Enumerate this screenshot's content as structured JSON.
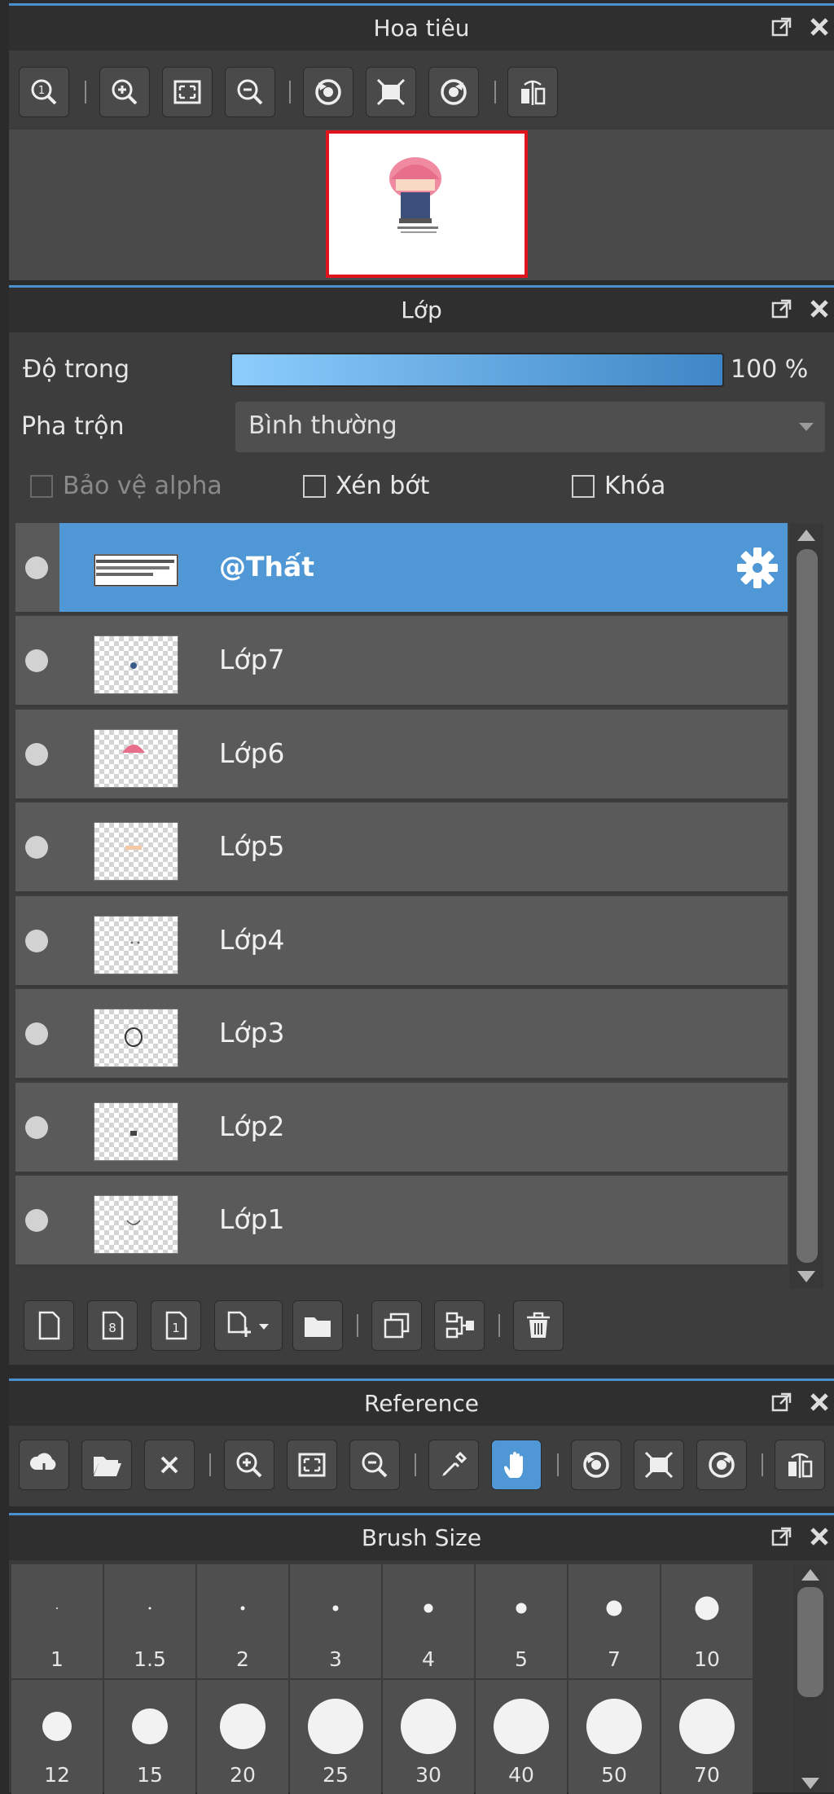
{
  "navigator": {
    "title": "Hoa tiêu",
    "buttons": [
      "zoom-actual-size",
      "zoom-in",
      "fit-to-window",
      "zoom-out",
      "rotate-left",
      "reset-rotation",
      "rotate-right",
      "flip-horizontal"
    ]
  },
  "layers": {
    "title": "Lớp",
    "opacity_label": "Độ trong",
    "opacity_value": "100 %",
    "opacity_fraction": 1.0,
    "blend_label": "Pha trộn",
    "blend_value": "Bình thường",
    "protect_alpha": "Bảo vệ alpha",
    "clipping": "Xén bớt",
    "lock": "Khóa",
    "items": [
      {
        "name": "@Thất",
        "selected": true
      },
      {
        "name": "Lớp7"
      },
      {
        "name": "Lớp6"
      },
      {
        "name": "Lớp5"
      },
      {
        "name": "Lớp4"
      },
      {
        "name": "Lớp3"
      },
      {
        "name": "Lớp2"
      },
      {
        "name": "Lớp1"
      }
    ],
    "footer_buttons": [
      "new-layer",
      "new-halftone-layer",
      "new-1bit-layer",
      "add-layer-menu",
      "new-folder",
      "duplicate-layer",
      "merge-layer",
      "delete-layer"
    ]
  },
  "reference": {
    "title": "Reference",
    "buttons": [
      "load-from-cloud",
      "open-file",
      "close",
      "zoom-in",
      "fit-to-window",
      "zoom-out",
      "eyedropper",
      "hand-tool",
      "rotate-left",
      "reset-rotation",
      "rotate-right",
      "flip-horizontal"
    ],
    "active": "hand-tool"
  },
  "brush_size": {
    "title": "Brush Size",
    "sizes": [
      "1",
      "1.5",
      "2",
      "3",
      "4",
      "5",
      "7",
      "10",
      "12",
      "15",
      "20",
      "25",
      "30",
      "40",
      "50",
      "70"
    ]
  },
  "colors": {
    "accent": "#4f97d5",
    "panel": "#3d3d3d",
    "title_bar": "#2f2f2f",
    "nav_frame": "#e0141d"
  }
}
